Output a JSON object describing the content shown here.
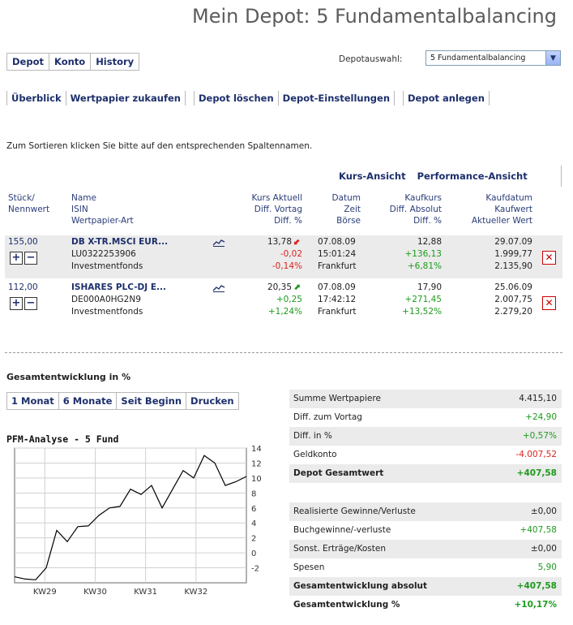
{
  "page_title": "Mein Depot: 5 Fundamentalbalancing",
  "tabs": [
    "Depot",
    "Konto",
    "History"
  ],
  "depot_select": {
    "label": "Depotauswahl:",
    "value": "5 Fundamentalbalancing"
  },
  "subnav": [
    "Überblick",
    "Wertpapier zukaufen",
    "Depot löschen",
    "Depot-Einstellungen",
    "Depot anlegen"
  ],
  "sort_hint": "Zum Sortieren klicken Sie bitte auf den entsprechenden Spaltennamen.",
  "views": [
    "Kurs-Ansicht",
    "Performance-Ansicht"
  ],
  "headers": {
    "col1": [
      "Stück/",
      "Nennwert"
    ],
    "col2": [
      "Name",
      "ISIN",
      "Wertpapier-Art"
    ],
    "col3": [
      "Kurs Aktuell",
      "Diff. Vortag",
      "Diff. %"
    ],
    "col4": [
      "Datum",
      "Zeit",
      "Börse"
    ],
    "col5": [
      "Kaufkurs",
      "Diff. Absolut",
      "Diff. %"
    ],
    "col6": [
      "Kaufdatum",
      "Kaufwert",
      "Aktueller Wert"
    ]
  },
  "positions": [
    {
      "qty": "155,00",
      "name": "DB X-TR.MSCI EUR...",
      "isin": "LU0322253906",
      "type": "Investmentfonds",
      "kurs": "13,78",
      "diff_vortag": "-0,02",
      "diff_pct": "-0,14%",
      "trend": "down",
      "datum": "07.08.09",
      "zeit": "15:01:24",
      "boerse": "Frankfurt",
      "kaufkurs": "12,88",
      "diff_abs": "+136,13",
      "diff_abs_pct": "+6,81%",
      "kaufdatum": "29.07.09",
      "kaufwert": "1.999,77",
      "aktueller_wert": "2.135,90"
    },
    {
      "qty": "112,00",
      "name": "ISHARES PLC-DJ E...",
      "isin": "DE000A0HG2N9",
      "type": "Investmentfonds",
      "kurs": "20,35",
      "diff_vortag": "+0,25",
      "diff_pct": "+1,24%",
      "trend": "up",
      "datum": "07.08.09",
      "zeit": "17:42:12",
      "boerse": "Frankfurt",
      "kaufkurs": "17,90",
      "diff_abs": "+271,45",
      "diff_abs_pct": "+13,52%",
      "kaufdatum": "25.06.09",
      "kaufwert": "2.007,75",
      "aktueller_wert": "2.279,20"
    }
  ],
  "section_title": "Gesamtentwicklung in %",
  "periods": [
    "1 Monat",
    "6 Monate",
    "Seit Beginn",
    "Drucken"
  ],
  "summary": [
    {
      "label": "Summe Wertpapiere",
      "value": "4.415,10",
      "color": "plain",
      "bold": false,
      "shaded": true
    },
    {
      "label": "Diff. zum Vortag",
      "value": "+24,90",
      "color": "green",
      "bold": false,
      "shaded": false
    },
    {
      "label": "Diff. in %",
      "value": "+0,57%",
      "color": "green",
      "bold": false,
      "shaded": true
    },
    {
      "label": "Geldkonto",
      "value": "-4.007,52",
      "color": "red",
      "bold": false,
      "shaded": false
    },
    {
      "label": "Depot Gesamtwert",
      "value": "+407,58",
      "color": "green",
      "bold": true,
      "shaded": true
    }
  ],
  "summary2": [
    {
      "label": "Realisierte Gewinne/Verluste",
      "value": "±0,00",
      "color": "plain",
      "bold": false,
      "shaded": true
    },
    {
      "label": "Buchgewinne/-verluste",
      "value": "+407,58",
      "color": "green",
      "bold": false,
      "shaded": false
    },
    {
      "label": "Sonst. Erträge/Kosten",
      "value": "±0,00",
      "color": "plain",
      "bold": false,
      "shaded": true
    },
    {
      "label": "Spesen",
      "value": "5,90",
      "color": "green",
      "bold": false,
      "shaded": false
    },
    {
      "label": "Gesamtentwicklung absolut",
      "value": "+407,58",
      "color": "green",
      "bold": true,
      "shaded": true
    },
    {
      "label": "Gesamtentwicklung %",
      "value": "+10,17%",
      "color": "green",
      "bold": true,
      "shaded": false
    }
  ],
  "chart_data": {
    "type": "line",
    "title": "PFM-Analyse - 5 Fund",
    "x_ticks": [
      "KW29",
      "KW30",
      "KW31",
      "KW32"
    ],
    "ylim": [
      -4,
      14
    ],
    "y_ticks": [
      -2,
      0,
      2,
      4,
      6,
      8,
      10,
      12,
      14
    ],
    "grid": true,
    "series": [
      {
        "values": [
          -3.2,
          -3.5,
          -3.6,
          -2.0,
          3.0,
          1.5,
          3.5,
          3.6,
          5.0,
          6.0,
          6.2,
          8.5,
          7.8,
          9.0,
          6.0,
          8.5,
          11.0,
          10.0,
          13.0,
          12.0,
          9.0,
          9.5,
          10.2
        ]
      }
    ],
    "line_color": "#000000"
  }
}
